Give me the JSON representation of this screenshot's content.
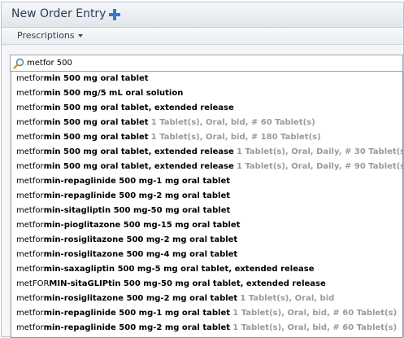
{
  "header": {
    "title": "New Order Entry"
  },
  "toolbar": {
    "prescriptions_label": "Prescriptions"
  },
  "search": {
    "value": "metfor 500"
  },
  "suggestions": [
    {
      "q": "metfor",
      "b": "min 500 mg oral tablet",
      "g": ""
    },
    {
      "q": "metfor",
      "b": "min 500 mg/5 mL oral solution",
      "g": ""
    },
    {
      "q": "metfor",
      "b": "min 500 mg oral tablet, extended release",
      "g": ""
    },
    {
      "q": "metfor",
      "b": "min 500 mg oral tablet",
      "g": "1 Tablet(s), Oral, bid, # 60 Tablet(s)"
    },
    {
      "q": "metfor",
      "b": "min 500 mg oral tablet",
      "g": "1 Tablet(s), Oral, bid, # 180 Tablet(s)"
    },
    {
      "q": "metfor",
      "b": "min 500 mg oral tablet, extended release",
      "g": "1 Tablet(s), Oral, Daily, # 30 Tablet(s)"
    },
    {
      "q": "metfor",
      "b": "min 500 mg oral tablet, extended release",
      "g": "1 Tablet(s), Oral, Daily, # 90 Tablet(s)"
    },
    {
      "q": "metfor",
      "b": "min-repaglinide 500 mg-1 mg oral tablet",
      "g": ""
    },
    {
      "q": "metfor",
      "b": "min-repaglinide 500 mg-2 mg oral tablet",
      "g": ""
    },
    {
      "q": "metfor",
      "b": "min-sitagliptin 500 mg-50 mg oral tablet",
      "g": ""
    },
    {
      "q": "metfor",
      "b": "min-pioglitazone 500 mg-15 mg oral tablet",
      "g": ""
    },
    {
      "q": "metfor",
      "b": "min-rosiglitazone 500 mg-2 mg oral tablet",
      "g": ""
    },
    {
      "q": "metfor",
      "b": "min-rosiglitazone 500 mg-4 mg oral tablet",
      "g": ""
    },
    {
      "q": "metfor",
      "b": "min-saxagliptin 500 mg-5 mg oral tablet, extended release",
      "g": ""
    },
    {
      "q": "metFOR",
      "b": "MIN-sitaGLIPtin 500 mg-50 mg oral tablet, extended release",
      "g": ""
    },
    {
      "q": "metfor",
      "b": "min-rosiglitazone 500 mg-2 mg oral tablet",
      "g": "1 Tablet(s), Oral, bid"
    },
    {
      "q": "metfor",
      "b": "min-repaglinide 500 mg-1 mg oral tablet",
      "g": "1 Tablet(s), Oral, bid, # 60 Tablet(s)"
    },
    {
      "q": "metfor",
      "b": "min-repaglinide 500 mg-2 mg oral tablet",
      "g": "1 Tablet(s), Oral, bid, # 60 Tablet(s)"
    }
  ],
  "colors": {
    "accent": "#2f7bd6",
    "hint_gray": "#9a9a9a"
  }
}
